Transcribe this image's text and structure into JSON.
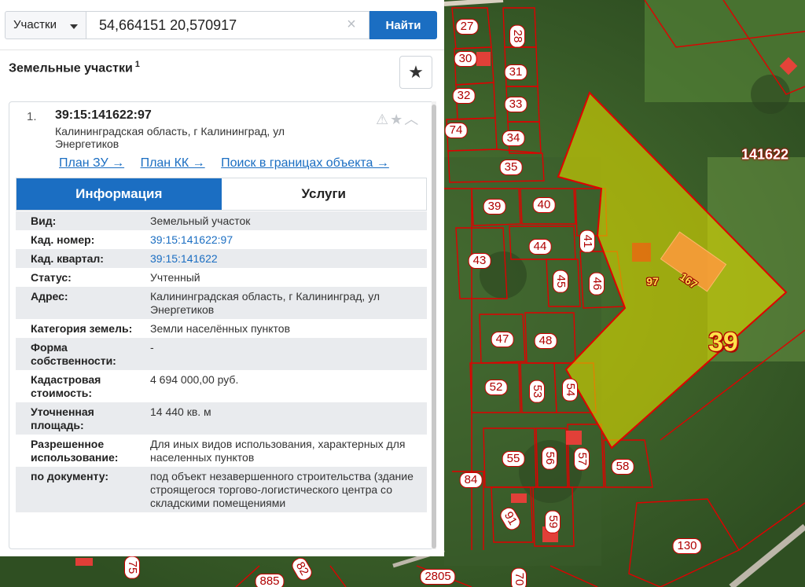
{
  "search": {
    "type_label": "Участки",
    "query": "54,664151 20,570917",
    "find_label": "Найти"
  },
  "results": {
    "title": "Земельные участки",
    "count": "1"
  },
  "card": {
    "index": "1.",
    "cad_number": "39:15:141622:97",
    "address": "Калининградская область, г Калининград, ул Энергетиков",
    "links": [
      "План ЗУ →",
      "План КК →",
      "Поиск в границах объекта →"
    ]
  },
  "tabs": {
    "info": "Информация",
    "services": "Услуги"
  },
  "info_rows": [
    {
      "key": "Вид:",
      "value": "Земельный участок"
    },
    {
      "key": "Кад. номер:",
      "value": "39:15:141622:97"
    },
    {
      "key": "Кад. квартал:",
      "value": "39:15:141622"
    },
    {
      "key": "Статус:",
      "value": "Учтенный"
    },
    {
      "key": "Адрес:",
      "value": "Калининградская область, г Калининград, ул Энергетиков"
    },
    {
      "key": "Категория земель:",
      "value": "Земли населённых пунктов"
    },
    {
      "key": "Форма собственности:",
      "value": "-"
    },
    {
      "key": "Кадастровая стоимость:",
      "value": "4 694 000,00 руб."
    },
    {
      "key": "Уточненная площадь:",
      "value": "14 440 кв. м"
    },
    {
      "key": "Разрешенное использование:",
      "value": "Для иных видов использования, характерных для населенных пунктов"
    },
    {
      "key": "по документу:",
      "value": "под объект незавершенного строительства (здание строящегося торгово-логистического центра со складскими помещениями"
    }
  ],
  "map": {
    "quarter_label": "141622",
    "big_label": "39",
    "plot_97": "97",
    "plot_167": "167",
    "plot_labels": [
      "27",
      "28",
      "30",
      "31",
      "32",
      "33",
      "74",
      "34",
      "35",
      "39",
      "40",
      "41",
      "43",
      "44",
      "45",
      "46",
      "47",
      "48",
      "52",
      "53",
      "54",
      "55",
      "56",
      "57",
      "58",
      "84",
      "91",
      "59",
      "130",
      "75",
      "82",
      "885",
      "2805",
      "70"
    ],
    "colors": {
      "highlight": "#d9d600",
      "border": "#d00000",
      "building": "#ff9a3c"
    }
  }
}
